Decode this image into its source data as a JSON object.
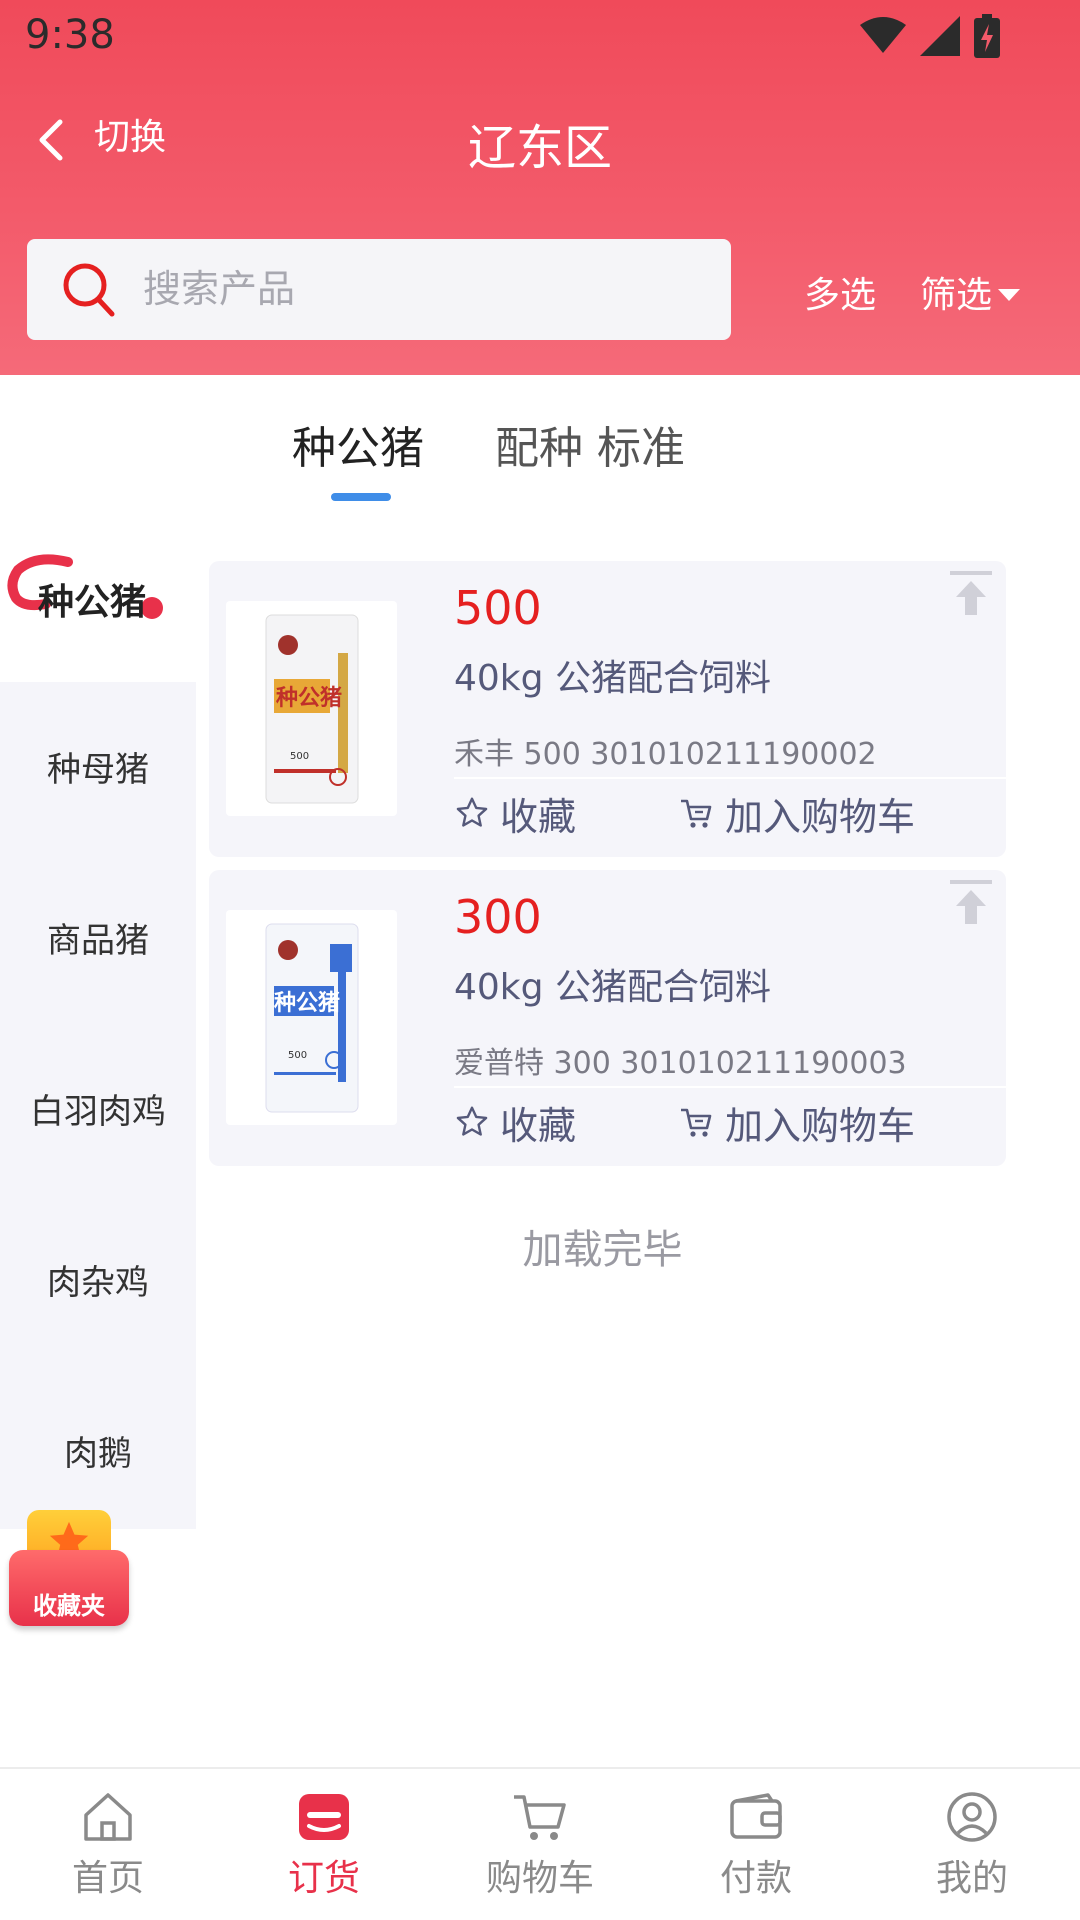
{
  "status_bar": {
    "time": "9:38"
  },
  "header": {
    "back_label": "切换",
    "title": "辽东区",
    "search_placeholder": "搜索产品",
    "multi_select": "多选",
    "filter": "筛选"
  },
  "tabs": [
    {
      "label": "种公猪",
      "active": true
    },
    {
      "label": "配种 标准",
      "active": false
    }
  ],
  "sidebar": {
    "items": [
      "种公猪",
      "种母猪",
      "商品猪",
      "白羽肉鸡",
      "肉杂鸡",
      "肉鹅"
    ]
  },
  "products": [
    {
      "price": "500",
      "name": "40kg 公猪配合饲料",
      "code": "禾丰 500 301010211190002",
      "fav_label": "收藏",
      "cart_label": "加入购物车"
    },
    {
      "price": "300",
      "name": "40kg 公猪配合饲料",
      "code": "爱普特 300 301010211190003",
      "fav_label": "收藏",
      "cart_label": "加入购物车"
    }
  ],
  "bag_artwork": {
    "brand_text": "种公猪",
    "spec": "500"
  },
  "loaded_text": "加载完毕",
  "fav_folder": {
    "label": "收藏夹"
  },
  "bottom_nav": [
    {
      "label": "首页",
      "icon": "home-icon"
    },
    {
      "label": "订货",
      "icon": "order-icon",
      "active": true
    },
    {
      "label": "购物车",
      "icon": "cart-icon"
    },
    {
      "label": "付款",
      "icon": "wallet-icon"
    },
    {
      "label": "我的",
      "icon": "profile-icon"
    }
  ],
  "colors": {
    "header": "#f04a5a",
    "price": "#e52020",
    "tab_indicator": "#3f8de8",
    "nav_active": "#e8314a"
  }
}
